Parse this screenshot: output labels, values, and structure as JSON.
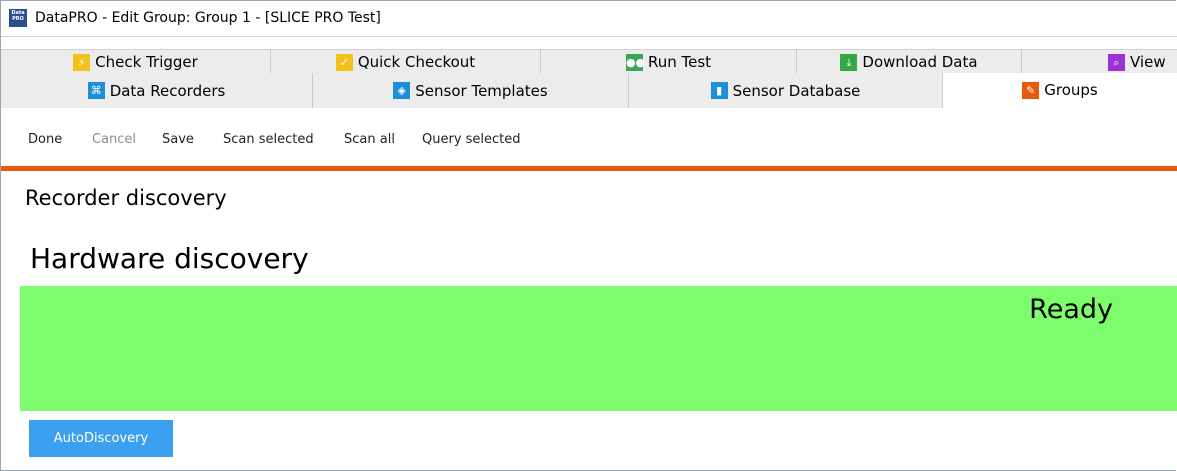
{
  "window": {
    "title": "DataPRO - Edit Group: Group 1  - [SLICE PRO Test]",
    "app_icon_text": "Data PRO"
  },
  "tabs_row1": [
    {
      "label": "Check Trigger",
      "icon": "trigger-icon"
    },
    {
      "label": "Quick Checkout",
      "icon": "checkout-icon"
    },
    {
      "label": "Run Test",
      "icon": "run-test-icon"
    },
    {
      "label": "Download Data",
      "icon": "download-icon"
    },
    {
      "label": "View",
      "icon": "view-icon"
    }
  ],
  "tabs_row2": [
    {
      "label": "Data Recorders",
      "icon": "recorders-icon"
    },
    {
      "label": "Sensor Templates",
      "icon": "templates-icon"
    },
    {
      "label": "Sensor Database",
      "icon": "database-icon"
    },
    {
      "label": "Groups",
      "icon": "groups-icon",
      "active": true
    }
  ],
  "toolbar": {
    "done": "Done",
    "cancel": "Cancel",
    "save": "Save",
    "scan_selected": "Scan selected",
    "scan_all": "Scan all",
    "query_selected": "Query selected"
  },
  "main": {
    "section_title": "Recorder discovery",
    "hardware_title": "Hardware discovery",
    "status": "Ready",
    "autodiscovery_button": "AutoDiscovery"
  },
  "colors": {
    "accent_line": "#e8590c",
    "status_ready": "#7dfd6e",
    "button_blue": "#3aa0ef"
  }
}
